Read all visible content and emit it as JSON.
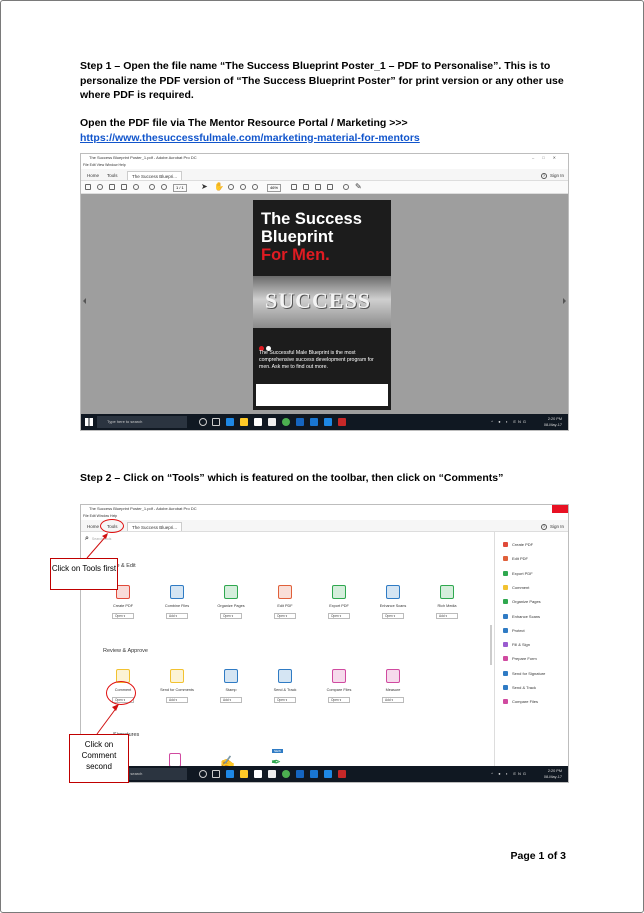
{
  "step1": {
    "label": "Step 1",
    "text": " – Open the file name “The Success Blueprint Poster_1 – PDF to Personalise”.  This is to personalize the PDF version of “The Success Blueprint Poster” for print version or any other use where PDF is required.",
    "portal_text": "Open the PDF file via The Mentor Resource Portal / Marketing >>>",
    "link": "https://www.thesuccessfulmale.com/marketing-material-for-mentors"
  },
  "shot1": {
    "window_title": "The Success Blueprint Poster_1.pdf - Adobe Acrobat Pro DC",
    "menu": "File  Edit  View  Window  Help",
    "tabs": [
      "Home",
      "Tools",
      "The Success Bluepri..."
    ],
    "signin": "Sign In",
    "zoom": "46%",
    "page_indicator": "1 / 1",
    "poster": {
      "title_line1": "The Success",
      "title_line2": "Blueprint",
      "title_line3": "For Men.",
      "image_word": "SUCCESS",
      "description": "The Successful Male Blueprint is the most comprehensive success development program for men. Ask me to find out more."
    },
    "taskbar": {
      "search_placeholder": "Type here to search",
      "time": "2:20 PM",
      "date": "08-May-17",
      "lang": "ENG"
    }
  },
  "step2": {
    "label": "Step 2",
    "text": " – Click on “Tools” which is featured on the toolbar, then click on “Comments”"
  },
  "shot2": {
    "window_title": "The Success Blueprint Poster_1.pdf - Adobe Acrobat Pro DC",
    "menu": "File  Edit  Window  Help",
    "tabs": [
      "Home",
      "Tools",
      "The Success Bluepri..."
    ],
    "signin": "Sign In",
    "search_placeholder": "Search tools",
    "section_create": "Create & Edit",
    "section_review": "Review & Approve",
    "section_sign": "Signatures",
    "new_badge": "NEW",
    "create_tools": [
      {
        "label": "Create PDF",
        "action": "Open",
        "color": "#e04a3a"
      },
      {
        "label": "Combine Files",
        "action": "Add",
        "color": "#2f7bc4"
      },
      {
        "label": "Organize Pages",
        "action": "Open",
        "color": "#2fa84f"
      },
      {
        "label": "Edit PDF",
        "action": "Open",
        "color": "#e0603a"
      },
      {
        "label": "Export PDF",
        "action": "Open",
        "color": "#2fa84f"
      },
      {
        "label": "Enhance Scans",
        "action": "Open",
        "color": "#2f7bc4"
      },
      {
        "label": "Rich Media",
        "action": "Add",
        "color": "#2fa84f"
      }
    ],
    "review_tools": [
      {
        "label": "Comment",
        "action": "Open",
        "color": "#f2c230"
      },
      {
        "label": "Send for Comments",
        "action": "Add",
        "color": "#f2c230"
      },
      {
        "label": "Stamp",
        "action": "Add",
        "color": "#2f7bc4"
      },
      {
        "label": "Send & Track",
        "action": "Open",
        "color": "#2f7bc4"
      },
      {
        "label": "Compare Files",
        "action": "Open",
        "color": "#d04aa0"
      },
      {
        "label": "Measure",
        "action": "Add",
        "color": "#d04aa0"
      }
    ],
    "right_panel": [
      {
        "label": "Create PDF",
        "color": "#e04a3a"
      },
      {
        "label": "Edit PDF",
        "color": "#e0603a"
      },
      {
        "label": "Export PDF",
        "color": "#2fa84f"
      },
      {
        "label": "Comment",
        "color": "#f2c230"
      },
      {
        "label": "Organize Pages",
        "color": "#2fa84f"
      },
      {
        "label": "Enhance Scans",
        "color": "#2f7bc4"
      },
      {
        "label": "Protect",
        "color": "#2f7bc4"
      },
      {
        "label": "Fill & Sign",
        "color": "#9a5bd0"
      },
      {
        "label": "Prepare Form",
        "color": "#d04aa0"
      },
      {
        "label": "Send for Signature",
        "color": "#2f7bc4"
      },
      {
        "label": "Send & Track",
        "color": "#2f7bc4"
      },
      {
        "label": "Compare Files",
        "color": "#d04aa0"
      }
    ],
    "callout_tools": "Click on Tools first",
    "callout_comment": "Click on Comment second",
    "taskbar": {
      "search_placeholder": "Type here to search",
      "time": "2:20 PM",
      "date": "08-May-17",
      "lang": "ENG"
    }
  },
  "footer": {
    "page_number": "Page 1 of 3"
  }
}
